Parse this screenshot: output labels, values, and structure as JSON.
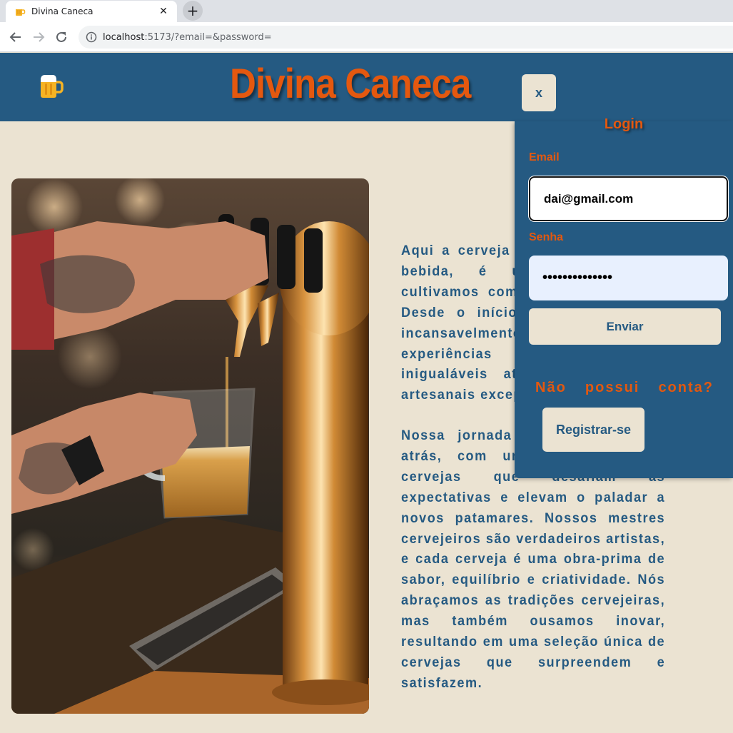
{
  "browser": {
    "tab_title": "Divina Caneca",
    "tab_close": "✕",
    "new_tab": "+",
    "url_host": "localhost",
    "url_rest": ":5173/?email=&password="
  },
  "site": {
    "title": "Divina Caneca",
    "logo_icon": "beer-mug-icon"
  },
  "article": {
    "paragraph1": "Aqui a cerveja é mais do que uma bebida, é uma paixão que cultivamos com dedicação e amor. Desde o início, temos trabalhado incansavelmente para criar experiências gastronômicas inigualáveis através de cervejas artesanais excepcionais.",
    "paragraph2": "Nossa jornada começou há anos atrás, com um sonho de criar cervejas que desafiam as expectativas e elevam o paladar a novos patamares. Nossos mestres cervejeiros são verdadeiros artistas, e cada cerveja é uma obra-prima de sabor, equilíbrio e criatividade. Nós abraçamos as tradições cervejeiras, mas também ousamos inovar, resultando em uma seleção única de cervejas que surpreendem e satisfazem."
  },
  "login": {
    "close_label": "x",
    "title": "Login",
    "email_label": "Email",
    "email_value": "dai@gmail.com",
    "password_label": "Senha",
    "password_mask": "••••••••••••••",
    "submit_label": "Enviar",
    "no_account_words": [
      "Não",
      "possui",
      "conta?"
    ],
    "register_label": "Registrar-se"
  },
  "colors": {
    "brand_blue": "#255a82",
    "brand_orange": "#e4580f",
    "cream": "#ebe3d2"
  }
}
